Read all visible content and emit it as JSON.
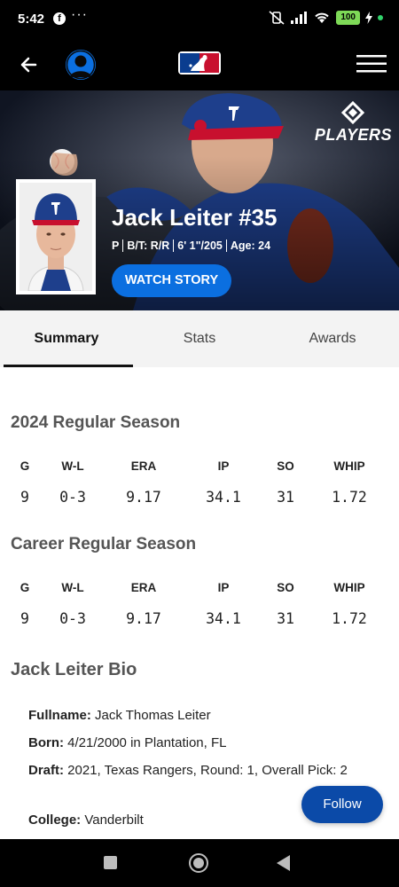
{
  "status_bar": {
    "time": "5:42",
    "dots": "···",
    "battery": "100"
  },
  "app_bar": {
    "back_icon": "arrow-left-icon",
    "profile_icon": "user-avatar-icon",
    "logo": "mlb-logo",
    "menu_icon": "hamburger-menu-icon"
  },
  "hero": {
    "logo_text": "PLAYERS",
    "name": "Jack Leiter #35",
    "position": "P",
    "bats_throws": "B/T: R/R",
    "height_weight": "6' 1\"/205",
    "age": "Age: 24",
    "watch_label": "WATCH STORY"
  },
  "tabs": [
    {
      "label": "Summary",
      "active": true
    },
    {
      "label": "Stats",
      "active": false
    },
    {
      "label": "Awards",
      "active": false
    }
  ],
  "season": {
    "title": "2024 Regular Season",
    "headers": [
      "G",
      "W-L",
      "ERA",
      "IP",
      "SO",
      "WHIP"
    ],
    "values": [
      "9",
      "0-3",
      "9.17",
      "34.1",
      "31",
      "1.72"
    ]
  },
  "career": {
    "title": "Career Regular Season",
    "headers": [
      "G",
      "W-L",
      "ERA",
      "IP",
      "SO",
      "WHIP"
    ],
    "values": [
      "9",
      "0-3",
      "9.17",
      "34.1",
      "31",
      "1.72"
    ]
  },
  "bio": {
    "title": "Jack Leiter Bio",
    "fullname_label": "Fullname:",
    "fullname": "Jack Thomas Leiter",
    "born_label": "Born:",
    "born": "4/21/2000 in Plantation, FL",
    "draft_label": "Draft:",
    "draft": "2021, Texas Rangers, Round: 1, Overall Pick: 2",
    "college_label": "College:",
    "college": "Vanderbilt"
  },
  "follow_label": "Follow",
  "colors": {
    "accent": "#0b6fe0",
    "follow": "#0b4aa8",
    "battery": "#7ed957"
  }
}
